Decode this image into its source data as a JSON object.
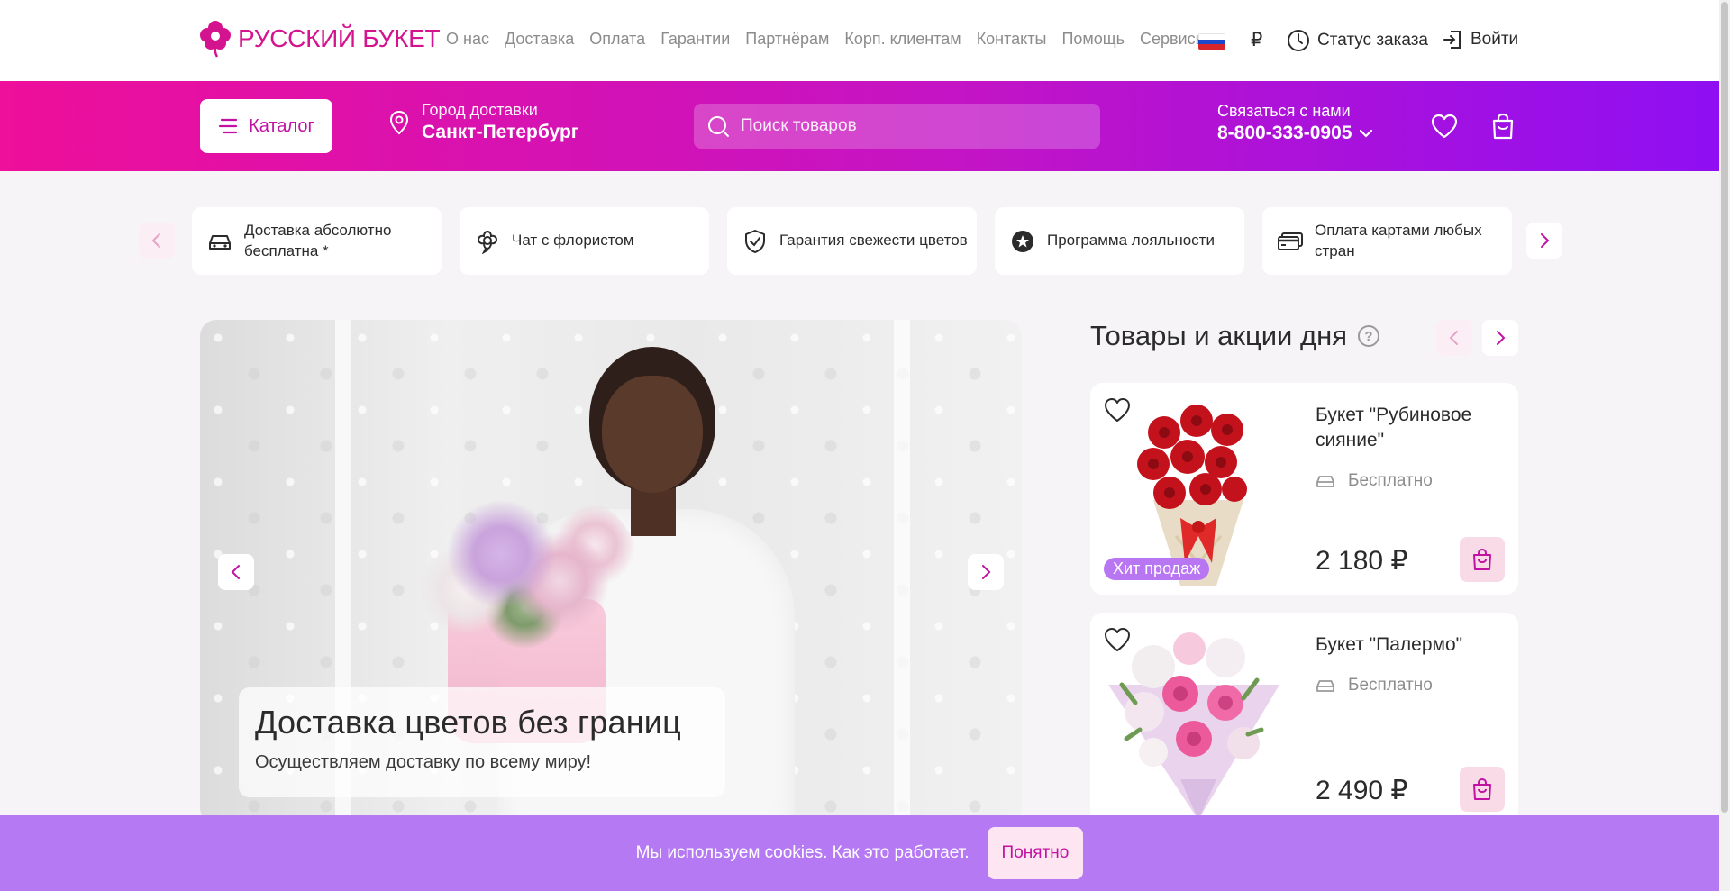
{
  "brand": {
    "logo_text": "РУССКИЙ БУКЕТ",
    "color": "#d4138f"
  },
  "top_nav": [
    "О нас",
    "Доставка",
    "Оплата",
    "Гарантии",
    "Партнёрам",
    "Корп. клиентам",
    "Контакты",
    "Помощь",
    "Сервисы"
  ],
  "currency": "₽",
  "order_status_label": "Статус заказа",
  "login_label": "Войти",
  "header": {
    "catalog_label": "Каталог",
    "city_label": "Город доставки",
    "city_value": "Санкт-Петербург",
    "search_placeholder": "Поиск товаров",
    "contact_label": "Связаться с нами",
    "phone": "8-800-333-0905",
    "gradient": [
      "#ee0f9a",
      "#8f0ff2"
    ]
  },
  "features": [
    {
      "icon": "car-icon",
      "text": "Доставка абсолютно бесплатна *"
    },
    {
      "icon": "florist-chat-icon",
      "text": "Чат с флористом"
    },
    {
      "icon": "shield-check-icon",
      "text": "Гарантия свежести цветов"
    },
    {
      "icon": "star-badge-icon",
      "text": "Программа лояльности"
    },
    {
      "icon": "credit-card-icon",
      "text": "Оплата картами любых стран"
    }
  ],
  "hero": {
    "title": "Доставка цветов без границ",
    "subtitle": "Осуществляем доставку по всему миру!"
  },
  "products_section": {
    "title": "Товары и акции дня",
    "items": [
      {
        "name": "Букет \"Рубиновое сияние\"",
        "delivery": "Бесплатно",
        "price": "2 180 ₽",
        "badge": "Хит продаж"
      },
      {
        "name": "Букет \"Палермо\"",
        "delivery": "Бесплатно",
        "price": "2 490 ₽",
        "badge": ""
      }
    ]
  },
  "cookie": {
    "text": "Мы используем cookies.",
    "link": "Как это работает",
    "button": "Понятно"
  }
}
